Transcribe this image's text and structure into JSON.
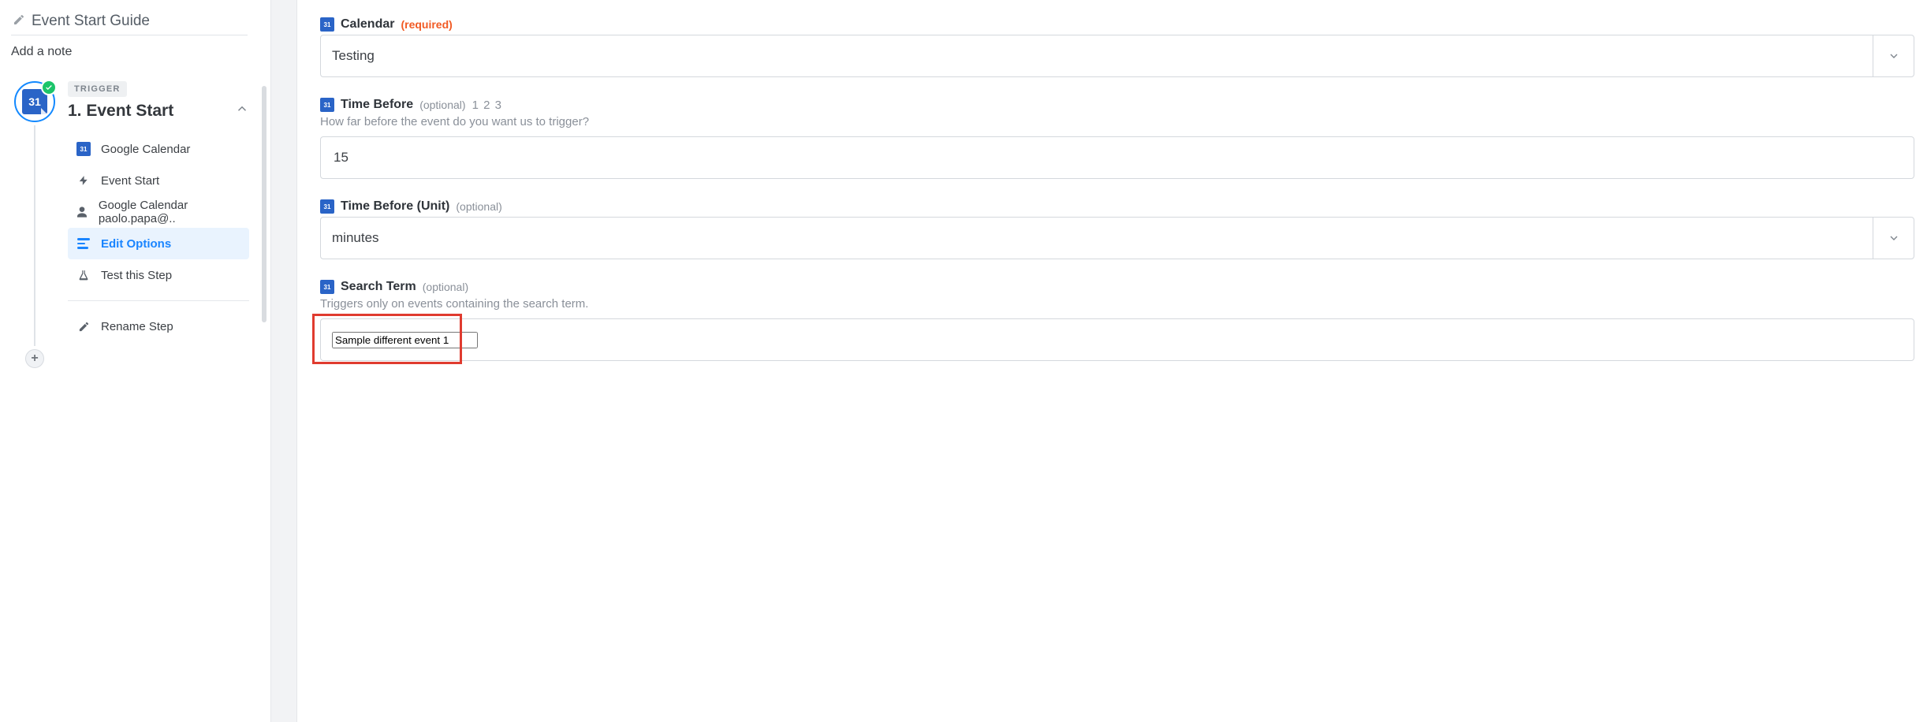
{
  "sidebar": {
    "title": "Event Start Guide",
    "add_note": "Add a note",
    "step": {
      "badge_label": "TRIGGER",
      "title": "1. Event Start",
      "nav": {
        "app": "Google Calendar",
        "trigger": "Event Start",
        "account": "Google Calendar paolo.papa@..",
        "edit": "Edit Options",
        "test": "Test this Step",
        "rename": "Rename Step"
      }
    }
  },
  "form": {
    "calendar": {
      "label": "Calendar",
      "required_text": "(required)",
      "value": "Testing"
    },
    "time_before": {
      "label": "Time Before",
      "optional_text": "(optional)",
      "tag": "1 2 3",
      "help": "How far before the event do you want us to trigger?",
      "value": "15"
    },
    "time_before_unit": {
      "label": "Time Before (Unit)",
      "optional_text": "(optional)",
      "value": "minutes"
    },
    "search_term": {
      "label": "Search Term",
      "optional_text": "(optional)",
      "help": "Triggers only on events containing the search term.",
      "value": "Sample different event 1"
    }
  }
}
